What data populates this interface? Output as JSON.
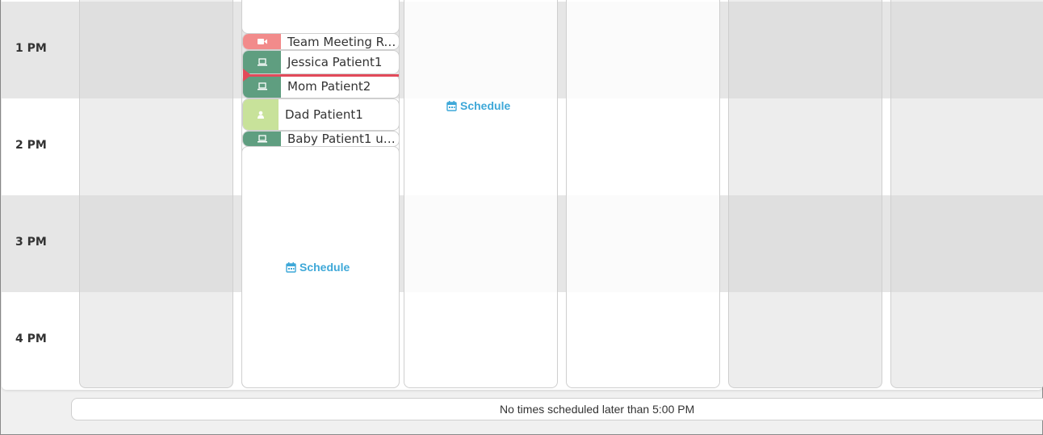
{
  "hours": [
    "1 PM",
    "2 PM",
    "3 PM",
    "4 PM"
  ],
  "appointments": [
    {
      "label": "Team Meeting Re...",
      "icon": "video-camera-icon",
      "color": "#f28b8b"
    },
    {
      "label": "Jessica Patient1",
      "icon": "laptop-icon",
      "color": "#5f9e80"
    },
    {
      "label": "Mom Patient2",
      "icon": "laptop-icon",
      "color": "#5f9e80"
    },
    {
      "label": "Dad Patient1",
      "icon": "person-icon",
      "color": "#c8e29a"
    },
    {
      "label": "Baby Patient1 un...",
      "icon": "laptop-icon",
      "color": "#5f9e80"
    }
  ],
  "schedule_links": [
    {
      "label": "Schedule",
      "icon": "calendar-icon"
    },
    {
      "label": "Schedule",
      "icon": "calendar-icon"
    }
  ],
  "footer": {
    "message": "No times scheduled later than 5:00 PM"
  },
  "colors": {
    "current_time_line": "#e24a5a",
    "schedule_link": "#3ea8d8",
    "telehealth": "#5f9e80",
    "video_meeting": "#f28b8b",
    "in_person": "#c8e29a"
  }
}
